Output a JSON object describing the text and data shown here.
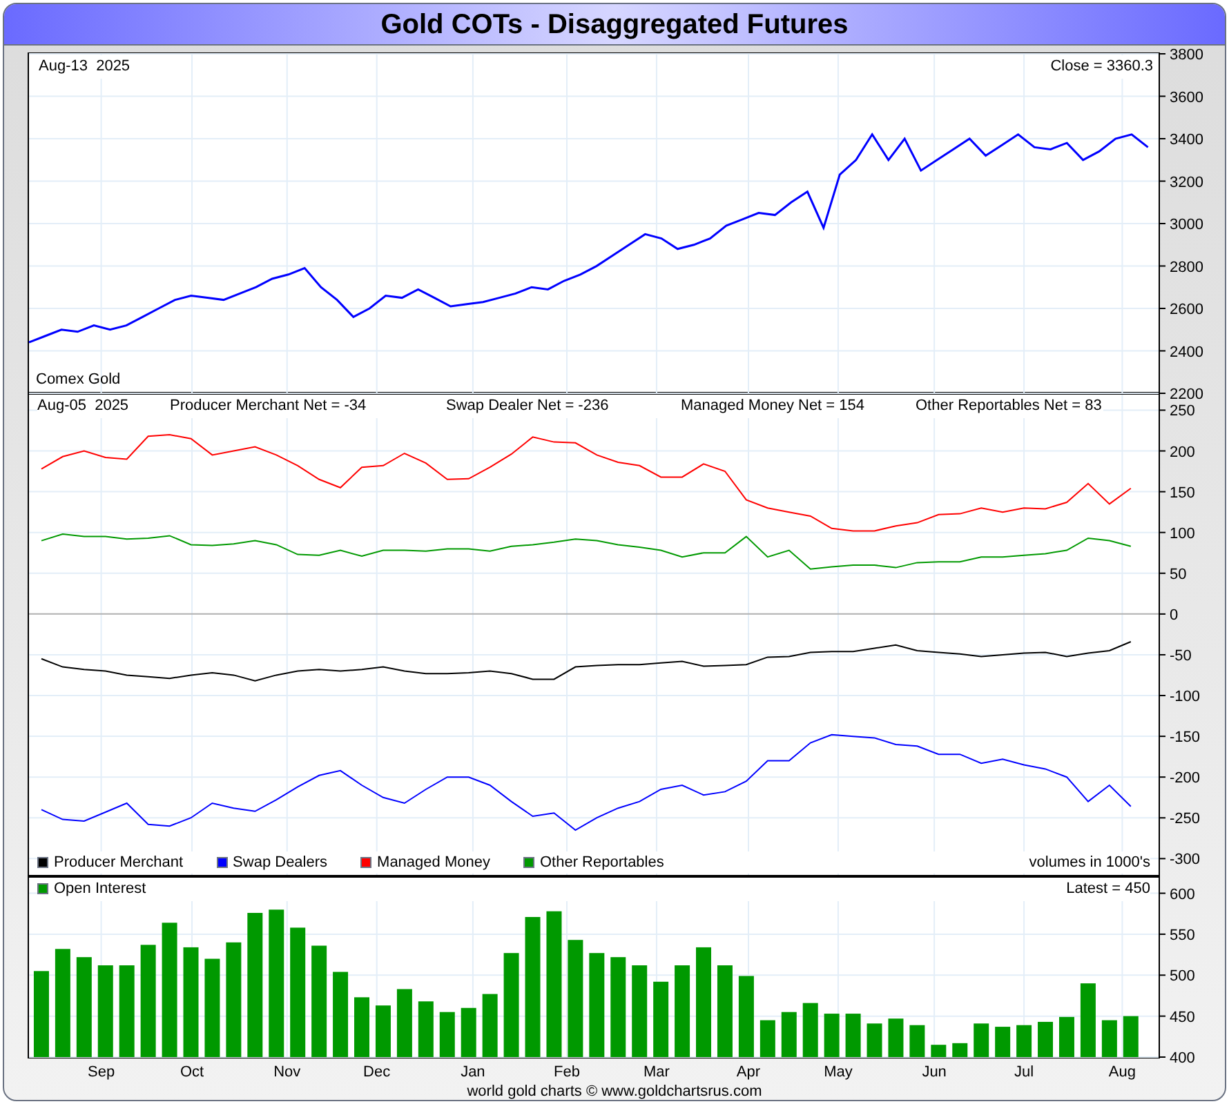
{
  "title": "Gold COTs - Disaggregated Futures",
  "price_panel": {
    "date": "Aug-13  2025",
    "close_label": "Close = 3360.3",
    "chart_data": {
      "type": "line",
      "grid": true,
      "ylim": [
        2200,
        3800
      ],
      "yticks": [
        2200,
        2400,
        2600,
        2800,
        3000,
        3200,
        3400,
        3600,
        3800
      ],
      "series": [
        {
          "name": "Comex Gold",
          "color": "#0000ff",
          "values": [
            2440,
            2470,
            2500,
            2490,
            2520,
            2500,
            2520,
            2560,
            2600,
            2640,
            2660,
            2650,
            2640,
            2670,
            2700,
            2740,
            2760,
            2790,
            2700,
            2640,
            2560,
            2600,
            2660,
            2650,
            2690,
            2650,
            2610,
            2620,
            2630,
            2650,
            2670,
            2700,
            2690,
            2730,
            2760,
            2800,
            2850,
            2900,
            2950,
            2930,
            2880,
            2900,
            2930,
            2990,
            3020,
            3050,
            3040,
            3100,
            3150,
            2980,
            3230,
            3300,
            3420,
            3300,
            3400,
            3250,
            3300,
            3350,
            3400,
            3320,
            3370,
            3420,
            3360,
            3350,
            3380,
            3300,
            3340,
            3400,
            3420,
            3360
          ]
        }
      ]
    }
  },
  "cot_panel": {
    "date": "Aug-05  2025",
    "net_labels": [
      "Producer Merchant Net = -34",
      "Swap Dealer Net = -236",
      "Managed Money Net = 154",
      "Other Reportables Net = 83"
    ],
    "units": "volumes in 1000's",
    "chart_data": {
      "type": "line",
      "grid": true,
      "ylim": [
        -320,
        269
      ],
      "yticks": [
        -300,
        -250,
        -200,
        -150,
        -100,
        -50,
        0,
        50,
        100,
        150,
        200,
        250
      ],
      "series": [
        {
          "name": "Producer Merchant",
          "color": "#000000",
          "values": [
            -55,
            -65,
            -68,
            -70,
            -75,
            -77,
            -79,
            -75,
            -72,
            -75,
            -82,
            -75,
            -70,
            -68,
            -70,
            -68,
            -65,
            -70,
            -73,
            -73,
            -72,
            -70,
            -73,
            -80,
            -80,
            -65,
            -63,
            -62,
            -62,
            -60,
            -58,
            -64,
            -63,
            -62,
            -53,
            -52,
            -47,
            -46,
            -46,
            -42,
            -38,
            -45,
            -47,
            -49,
            -52,
            -50,
            -48,
            -47,
            -52,
            -48,
            -45,
            -34
          ]
        },
        {
          "name": "Swap Dealers",
          "color": "#0000ff",
          "values": [
            -240,
            -252,
            -254,
            -243,
            -232,
            -258,
            -260,
            -250,
            -232,
            -238,
            -242,
            -228,
            -212,
            -198,
            -192,
            -210,
            -225,
            -232,
            -215,
            -200,
            -200,
            -210,
            -230,
            -248,
            -244,
            -265,
            -250,
            -238,
            -230,
            -215,
            -210,
            -222,
            -218,
            -205,
            -180,
            -180,
            -158,
            -148,
            -150,
            -152,
            -160,
            -162,
            -172,
            -172,
            -183,
            -178,
            -185,
            -190,
            -200,
            -230,
            -210,
            -236
          ]
        },
        {
          "name": "Managed Money",
          "color": "#ff0000",
          "values": [
            178,
            193,
            200,
            192,
            190,
            218,
            220,
            215,
            195,
            200,
            205,
            195,
            182,
            165,
            155,
            180,
            182,
            197,
            185,
            165,
            166,
            180,
            196,
            217,
            211,
            210,
            195,
            186,
            182,
            168,
            168,
            184,
            175,
            140,
            130,
            125,
            120,
            105,
            102,
            102,
            108,
            112,
            122,
            123,
            130,
            125,
            130,
            129,
            137,
            160,
            135,
            154
          ]
        },
        {
          "name": "Other Reportables",
          "color": "#009900",
          "values": [
            90,
            98,
            95,
            95,
            92,
            93,
            96,
            85,
            84,
            86,
            90,
            85,
            73,
            72,
            78,
            71,
            78,
            78,
            77,
            80,
            80,
            77,
            83,
            85,
            88,
            92,
            90,
            85,
            82,
            78,
            70,
            75,
            75,
            95,
            70,
            78,
            55,
            58,
            60,
            60,
            57,
            63,
            64,
            64,
            70,
            70,
            72,
            74,
            78,
            93,
            90,
            83
          ]
        }
      ]
    }
  },
  "oi_panel": {
    "latest": "Latest = 450",
    "chart_data": {
      "type": "bar",
      "grid": true,
      "ylim": [
        400,
        619
      ],
      "yticks": [
        400,
        450,
        500,
        550,
        600
      ],
      "series": [
        {
          "name": "Open Interest",
          "color": "#009900",
          "values": [
            505,
            532,
            522,
            512,
            512,
            537,
            564,
            534,
            520,
            540,
            576,
            580,
            558,
            536,
            504,
            473,
            463,
            483,
            468,
            455,
            460,
            477,
            527,
            571,
            578,
            543,
            527,
            522,
            512,
            492,
            512,
            534,
            512,
            499,
            445,
            455,
            466,
            453,
            453,
            441,
            447,
            439,
            415,
            417,
            441,
            437,
            439,
            443,
            449,
            490,
            445,
            450
          ]
        }
      ]
    }
  },
  "x_axis": {
    "labels": [
      "Sep",
      "Oct",
      "Nov",
      "Dec",
      "Jan",
      "Feb",
      "Mar",
      "Apr",
      "May",
      "Jun",
      "Jul",
      "Aug"
    ]
  },
  "footer": "world gold charts © www.goldchartsrus.com"
}
